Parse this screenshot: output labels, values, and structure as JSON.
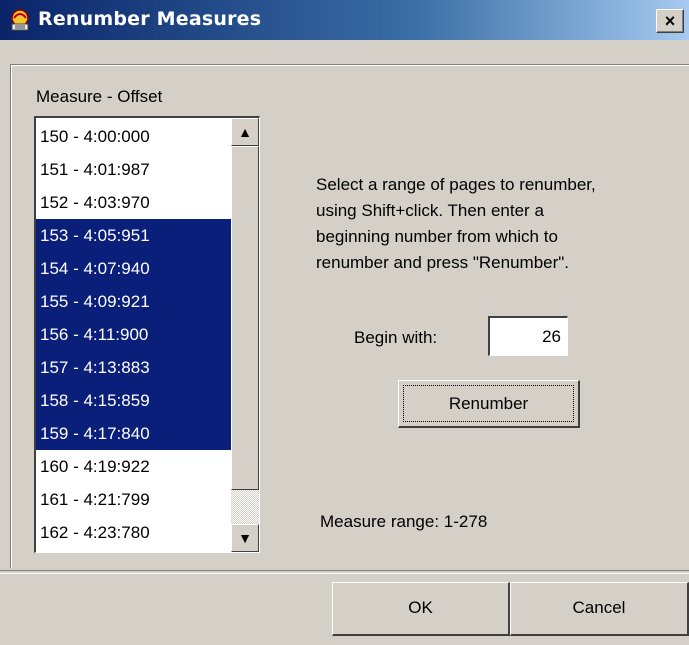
{
  "window": {
    "title": "Renumber Measures",
    "icon": "app-icon",
    "close_label": "×"
  },
  "list": {
    "label": "Measure - Offset",
    "items": [
      {
        "text": "150 - 4:00:000",
        "selected": false
      },
      {
        "text": "151 - 4:01:987",
        "selected": false
      },
      {
        "text": "152 - 4:03:970",
        "selected": false
      },
      {
        "text": "153 - 4:05:951",
        "selected": true
      },
      {
        "text": "154 - 4:07:940",
        "selected": true
      },
      {
        "text": "155 - 4:09:921",
        "selected": true
      },
      {
        "text": "156 - 4:11:900",
        "selected": true
      },
      {
        "text": "157 - 4:13:883",
        "selected": true
      },
      {
        "text": "158 - 4:15:859",
        "selected": true
      },
      {
        "text": "159 - 4:17:840",
        "selected": true
      },
      {
        "text": "160 - 4:19:922",
        "selected": false
      },
      {
        "text": "161 - 4:21:799",
        "selected": false
      },
      {
        "text": "162 - 4:23:780",
        "selected": false
      }
    ],
    "scroll_up_icon": "▲",
    "scroll_down_icon": "▼"
  },
  "instructions": {
    "line1": "Select a range of pages to renumber,",
    "line2": "using Shift+click.  Then enter a",
    "line3": "beginning number from which to",
    "line4": "renumber and press \"Renumber\"."
  },
  "begin": {
    "label": "Begin with:",
    "value": "26"
  },
  "renumber_button": "Renumber",
  "range": {
    "label": "Measure range:  1-278"
  },
  "footer": {
    "ok": "OK",
    "cancel": "Cancel"
  },
  "colors": {
    "selection": "#0a1f7a",
    "titlebar_start": "#0a246a",
    "titlebar_end": "#a6caf0",
    "face": "#d4d0c8"
  }
}
